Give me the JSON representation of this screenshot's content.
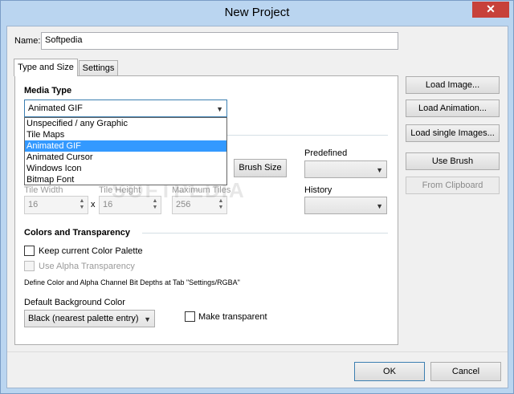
{
  "window": {
    "title": "New Project",
    "close_glyph": "✕"
  },
  "name_field": {
    "label": "Name:",
    "value": "Softpedia"
  },
  "tabs": [
    {
      "label": "Type and Size",
      "active": true
    },
    {
      "label": "Settings",
      "active": false
    }
  ],
  "media_type": {
    "heading": "Media Type",
    "selected": "Animated GIF",
    "options": [
      "Unspecified / any Graphic",
      "Tile Maps",
      "Animated GIF",
      "Animated Cursor",
      "Windows Icon",
      "Bitmap Font"
    ]
  },
  "size": {
    "brush_size_button": "Brush Size",
    "predefined_label": "Predefined",
    "history_label": "History",
    "tile_width_label": "Tile Width",
    "tile_width_value": "16",
    "x_sep": "x",
    "tile_height_label": "Tile Height",
    "tile_height_value": "16",
    "max_tiles_label": "Maximum Tiles",
    "max_tiles_value": "256"
  },
  "colors": {
    "heading": "Colors and Transparency",
    "keep_palette_label": "Keep current Color Palette",
    "alpha_label": "Use Alpha Transparency",
    "info_text": "Define Color and Alpha Channel Bit Depths at Tab \"Settings/RGBA\"",
    "bg_color_label": "Default Background Color",
    "bg_color_value": "Black (nearest palette entry)",
    "make_transparent_label": "Make transparent"
  },
  "side_buttons": {
    "load_image": "Load Image...",
    "load_animation": "Load Animation...",
    "load_single_images": "Load single Images...",
    "use_brush": "Use Brush",
    "from_clipboard": "From Clipboard"
  },
  "footer": {
    "ok": "OK",
    "cancel": "Cancel"
  },
  "watermark": "SOFTPEDIA",
  "colors_theme": {
    "titlebar": "#bad5f0",
    "close": "#c7413a",
    "selection": "#3399ff"
  }
}
